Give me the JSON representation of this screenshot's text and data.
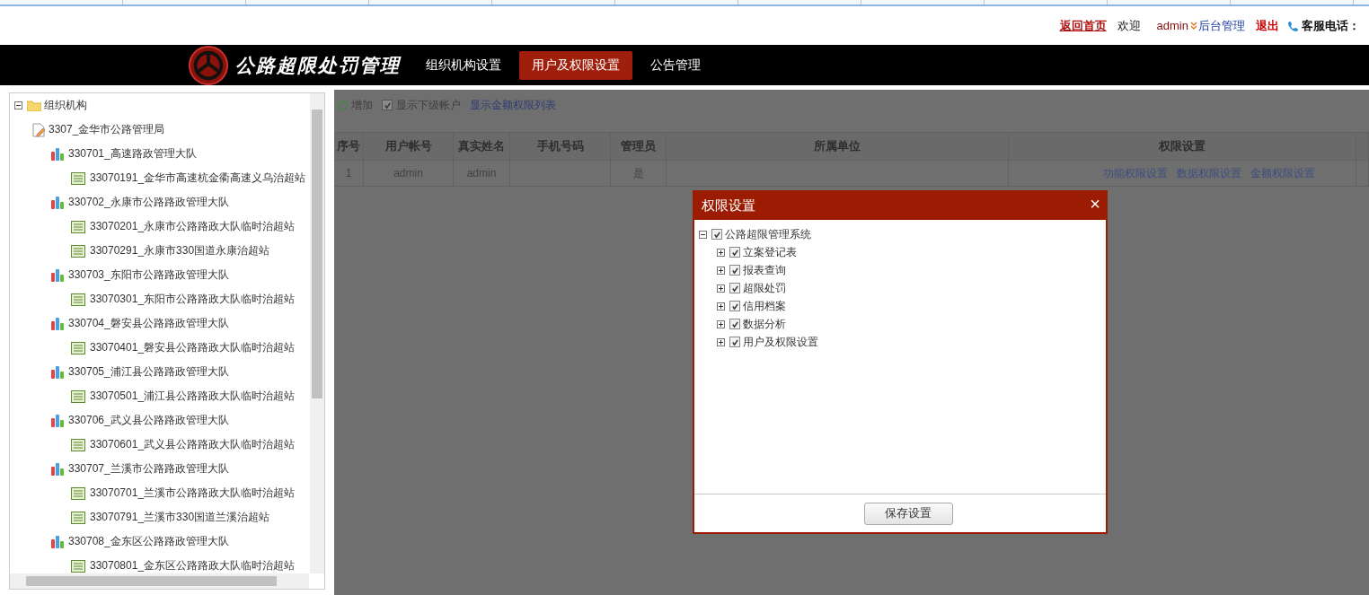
{
  "header": {
    "links": [
      {
        "kind": "home",
        "text": "返回首页"
      },
      {
        "kind": "plain",
        "text": "欢迎"
      },
      {
        "kind": "user",
        "text": "admin"
      },
      {
        "kind": "admin",
        "text": "后台管理"
      },
      {
        "kind": "logout",
        "text": "退出"
      },
      {
        "kind": "phone",
        "text": "客服电话："
      }
    ]
  },
  "nav": {
    "title": "公路超限处罚管理",
    "items": [
      {
        "label": "组织机构设置",
        "selected": false
      },
      {
        "label": "用户及权限设置",
        "selected": true
      },
      {
        "label": "公告管理",
        "selected": false
      }
    ]
  },
  "org_tree": {
    "label": "组织机构",
    "expanded": true,
    "children": [
      {
        "kind": "bureau",
        "label": "3307_金华市公路管理局",
        "children": [
          {
            "kind": "brigade",
            "label": "330701_高速路政管理大队",
            "children": [
              {
                "kind": "station",
                "label": "33070191_金华市高速杭金衢高速义乌治超站"
              }
            ]
          },
          {
            "kind": "brigade",
            "label": "330702_永康市公路路政管理大队",
            "children": [
              {
                "kind": "station",
                "label": "33070201_永康市公路路政大队临时治超站"
              },
              {
                "kind": "station",
                "label": "33070291_永康市330国道永康治超站"
              }
            ]
          },
          {
            "kind": "brigade",
            "label": "330703_东阳市公路路政管理大队",
            "children": [
              {
                "kind": "station",
                "label": "33070301_东阳市公路路政大队临时治超站"
              }
            ]
          },
          {
            "kind": "brigade",
            "label": "330704_磐安县公路路政管理大队",
            "children": [
              {
                "kind": "station",
                "label": "33070401_磐安县公路路政大队临时治超站"
              }
            ]
          },
          {
            "kind": "brigade",
            "label": "330705_浦江县公路路政管理大队",
            "children": [
              {
                "kind": "station",
                "label": "33070501_浦江县公路路政大队临时治超站"
              }
            ]
          },
          {
            "kind": "brigade",
            "label": "330706_武义县公路路政管理大队",
            "children": [
              {
                "kind": "station",
                "label": "33070601_武义县公路路政大队临时治超站"
              }
            ]
          },
          {
            "kind": "brigade",
            "label": "330707_兰溪市公路路政管理大队",
            "children": [
              {
                "kind": "station",
                "label": "33070701_兰溪市公路路政大队临时治超站"
              },
              {
                "kind": "station",
                "label": "33070791_兰溪市330国道兰溪治超站"
              }
            ]
          },
          {
            "kind": "brigade",
            "label": "330708_金东区公路路政管理大队",
            "children": [
              {
                "kind": "station",
                "label": "33070801_金东区公路路政大队临时治超站"
              }
            ]
          }
        ]
      }
    ]
  },
  "toolbar": {
    "add": "增加",
    "show_sub": {
      "label": "显示下级帐户",
      "checked": true
    },
    "link": "显示金额权限列表"
  },
  "table": {
    "columns": [
      "序号",
      "用户帐号",
      "真实姓名",
      "手机号码",
      "管理员",
      "所属单位",
      "权限设置"
    ],
    "rows": [
      {
        "index": "1",
        "account": "admin",
        "name": "admin",
        "admin": "是",
        "links": [
          "功能权限设置",
          "数据权限设置",
          "金额权限设置"
        ]
      }
    ]
  },
  "dialog": {
    "title": "权限设置",
    "close": "×",
    "tree": {
      "label": "公路超限管理系统",
      "checked": true,
      "expanded": true,
      "children": [
        {
          "label": "立案登记表",
          "checked": true,
          "expanded": false
        },
        {
          "label": "报表查询",
          "checked": true,
          "expanded": false
        },
        {
          "label": "超限处罚",
          "checked": true,
          "expanded": false
        },
        {
          "label": "信用档案",
          "checked": true,
          "expanded": false
        },
        {
          "label": "数据分析",
          "checked": true,
          "expanded": false
        },
        {
          "label": "用户及权限设置",
          "checked": true,
          "expanded": false
        }
      ]
    },
    "save": "保存设置"
  }
}
